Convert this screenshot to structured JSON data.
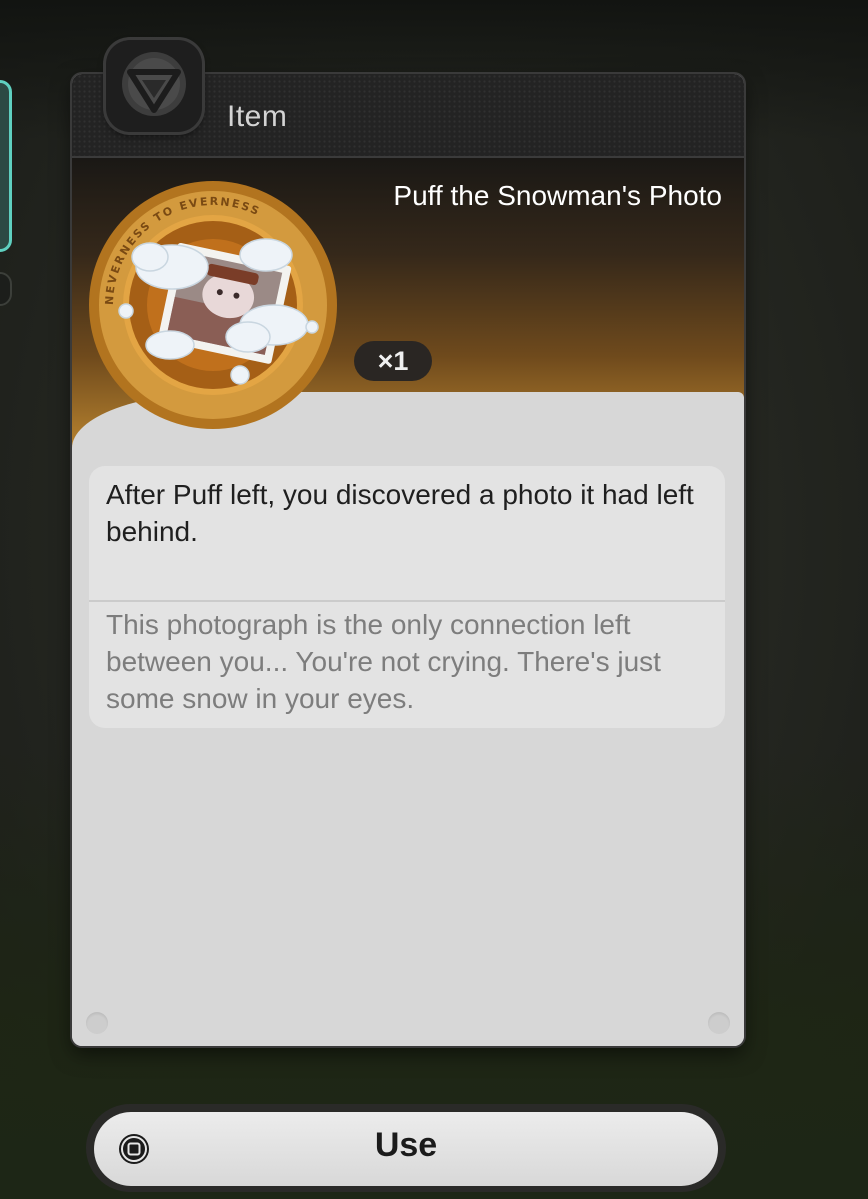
{
  "panel": {
    "header_title": "Item"
  },
  "item": {
    "name": "Puff the Snowman's Photo",
    "count": "×1",
    "emblem_ring_text": "NEVERNESS TO EVERNESS",
    "description": "After Puff left, you discovered a photo it had left behind.",
    "flavor_text": "This photograph is the only connection left between you... You're not crying. There's just some snow in your eyes."
  },
  "actions": {
    "use_label": "Use"
  },
  "colors": {
    "band_orange": "#c28a38",
    "emblem_ring": "#c68a30",
    "side_tab_accent": "#5fd0c0"
  },
  "icons": {
    "header_badge": "game-logo-icon",
    "use_key": "square-button-icon"
  }
}
